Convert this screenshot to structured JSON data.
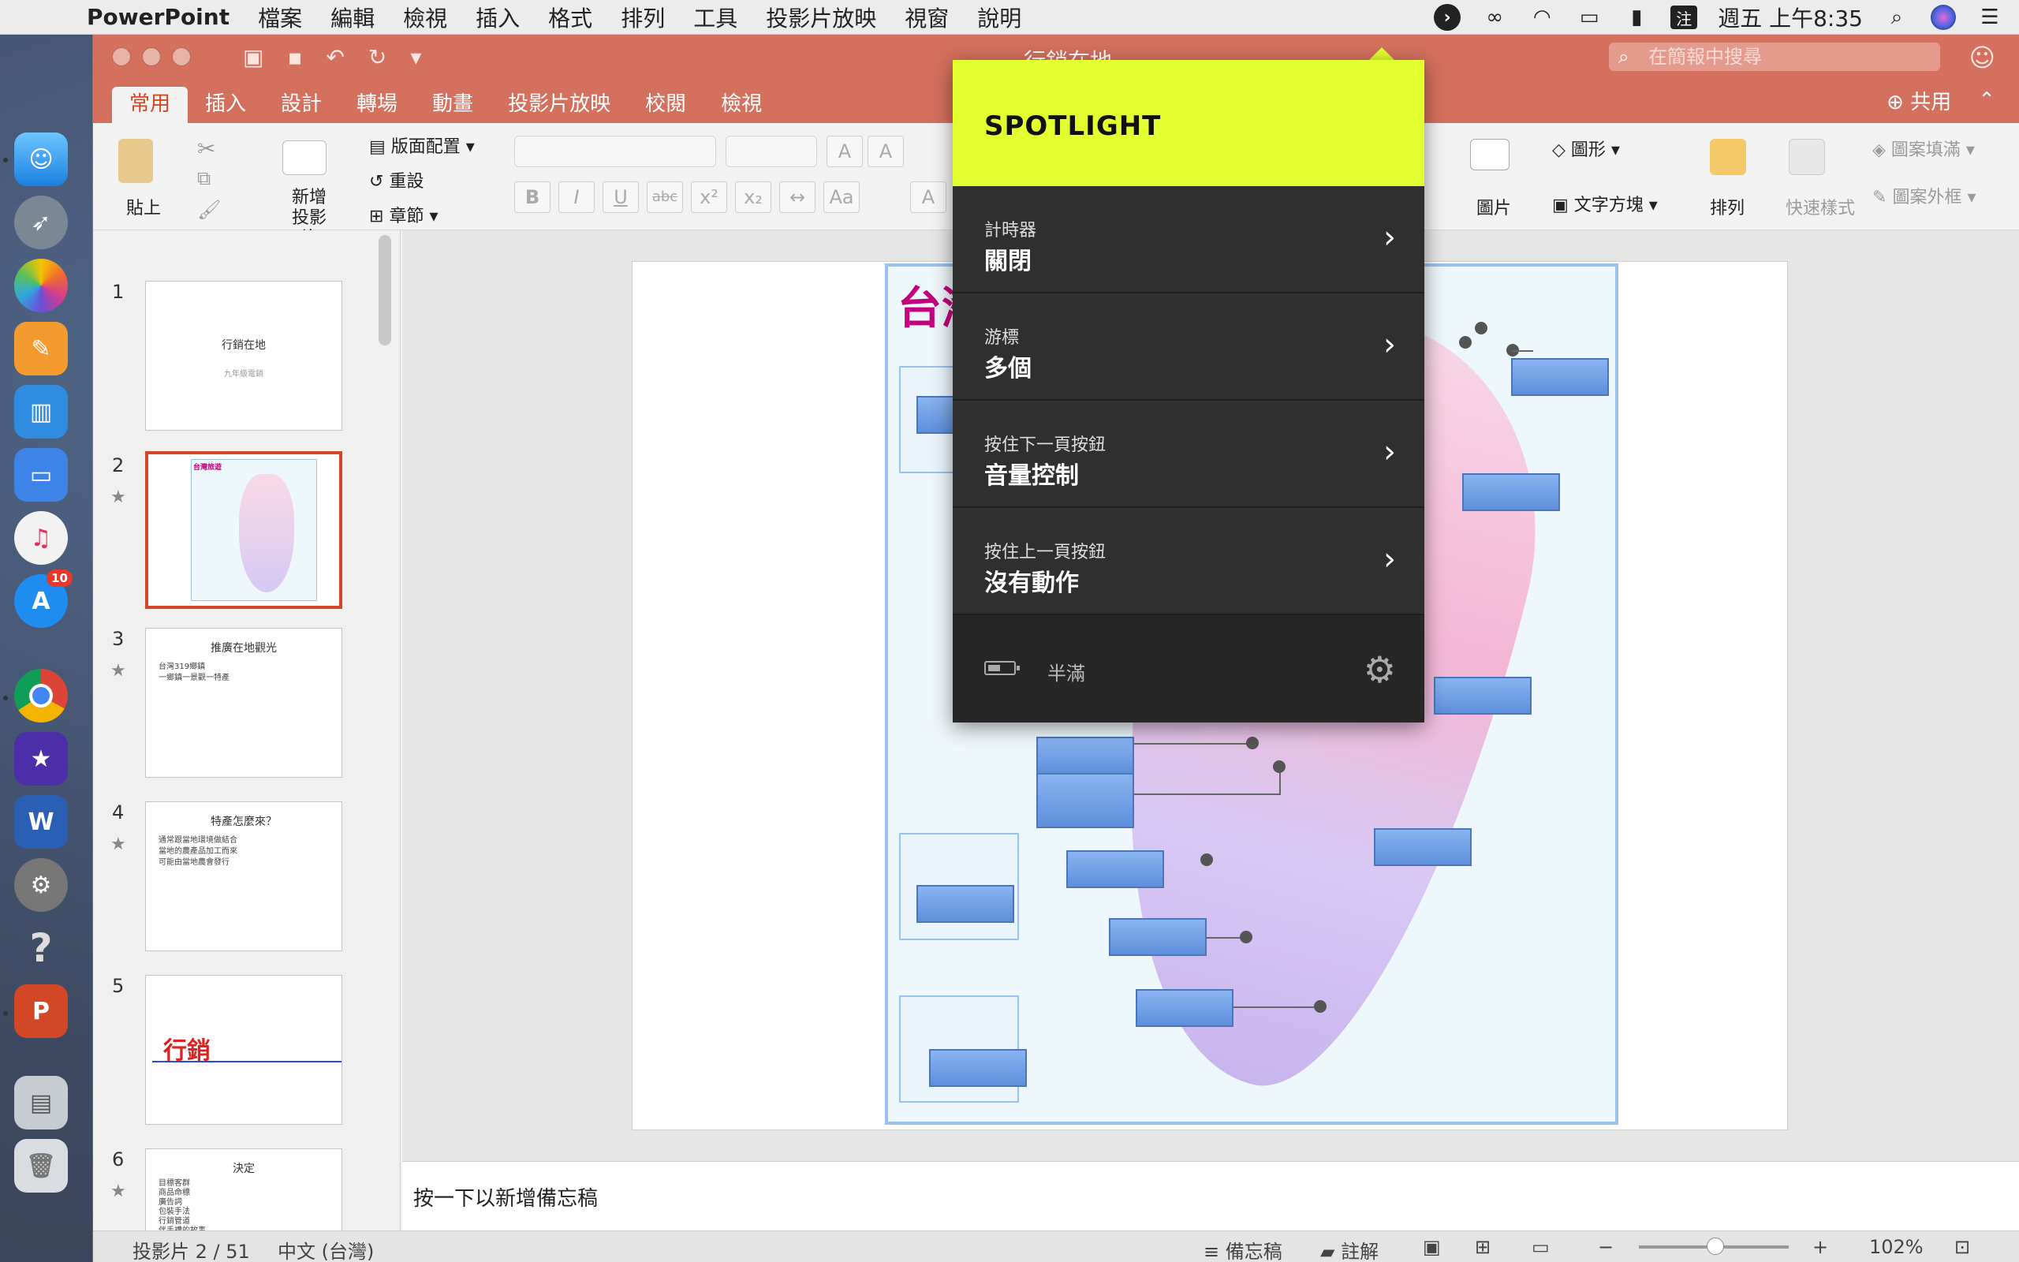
{
  "menubar": {
    "app": "PowerPoint",
    "items": [
      "檔案",
      "編輯",
      "檢視",
      "插入",
      "格式",
      "排列",
      "工具",
      "投影片放映",
      "視窗",
      "說明"
    ],
    "clock": "週五 上午8:35",
    "input_method": "注"
  },
  "window": {
    "doc_title": "行銷在地",
    "search_placeholder": "在簡報中搜尋",
    "tabs": [
      "常用",
      "插入",
      "設計",
      "轉場",
      "動畫",
      "投影片放映",
      "校閱",
      "檢視"
    ],
    "active_tab": "常用",
    "share_label": "共用"
  },
  "ribbon": {
    "paste": "貼上",
    "new_slide": "新增投影片",
    "layout": "版面配置",
    "reset": "重設",
    "section": "章節",
    "picture": "圖片",
    "shape": "圖形",
    "textbox": "文字方塊",
    "arrange": "排列",
    "quick_styles": "快速樣式",
    "shape_fill": "圖案填滿",
    "shape_outline": "圖案外框"
  },
  "slides": [
    {
      "num": "1",
      "title": "行銷在地",
      "subtitle": "九年級電銷"
    },
    {
      "num": "2",
      "title": "台灣旅遊"
    },
    {
      "num": "3",
      "title": "推廣在地觀光",
      "bullets": [
        "台灣319鄉鎮",
        "一鄉鎮一景觀一特產"
      ]
    },
    {
      "num": "4",
      "title": "特產怎麼來？",
      "bullets": [
        "通常跟當地環境做結合",
        "當地的農產品加工而來",
        "可能由當地農會發行"
      ]
    },
    {
      "num": "5",
      "title": "行銷"
    },
    {
      "num": "6",
      "title": "決定",
      "bullets": [
        "目標客群",
        "商品命標",
        "廣告詞",
        "包裝手法",
        "行銷管道",
        "伴手禮的故事"
      ]
    }
  ],
  "slide_main": {
    "map_title": "台灣"
  },
  "notes_placeholder": "按一下以新增備忘稿",
  "status": {
    "slide_counter": "投影片 2 / 51",
    "language": "中文 (台灣)",
    "notes_btn": "備忘稿",
    "comments_btn": "註解",
    "zoom": "102%",
    "zoom_level": 0.51
  },
  "spotlight": {
    "title": "SPOTLIGHT",
    "rows": [
      {
        "label": "計時器",
        "value": "關閉"
      },
      {
        "label": "游標",
        "value": "多個"
      },
      {
        "label": "按住下一頁按鈕",
        "value": "音量控制"
      },
      {
        "label": "按住上一頁按鈕",
        "value": "沒有動作"
      }
    ],
    "battery_text": "半滿",
    "battery_level": 0.5,
    "accent": "#e2ff2f"
  },
  "dock": {
    "app_store_badge": "10"
  }
}
